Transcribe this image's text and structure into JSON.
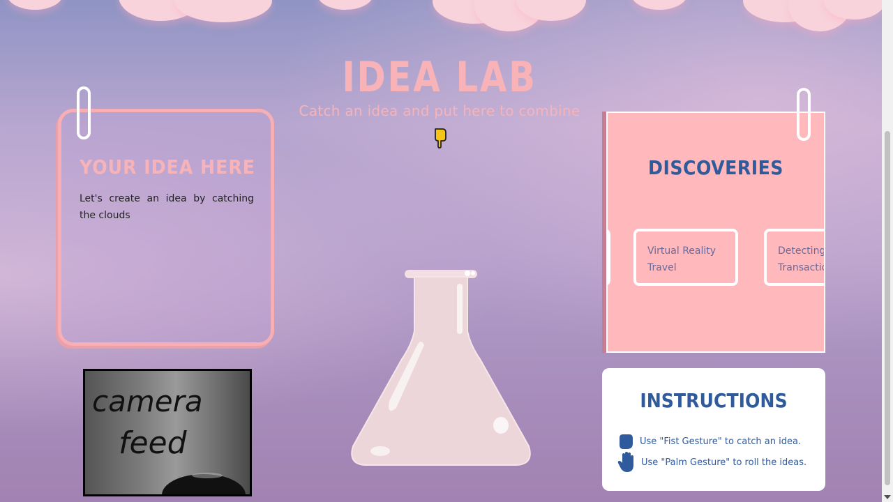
{
  "header": {
    "title": "IDEA LAB",
    "subtitle": "Catch an idea and put here to combine"
  },
  "idea_card": {
    "heading": "YOUR IDEA HERE",
    "text": "Let's create an idea by catching the clouds"
  },
  "discoveries": {
    "heading": "DISCOVERIES",
    "items": [
      {
        "label": ""
      },
      {
        "label": "Virtual Reality Travel"
      },
      {
        "label": "Detecting Transactions"
      }
    ]
  },
  "camera": {
    "label_line1": "camera",
    "label_line2": "feed"
  },
  "instructions": {
    "heading": "INSTRUCTIONS",
    "fist": "Use \"Fist Gesture\" to catch an idea.",
    "palm": "Use \"Palm Gesture\" to roll the ideas."
  },
  "colors": {
    "accent_pink": "#f7b3b8",
    "card_pink": "#ffb8bb",
    "text_blue": "#2f5a9b",
    "cursor_yellow": "#f5c518"
  },
  "icons": [
    "fist-icon",
    "palm-icon",
    "paperclip-icon",
    "hand-cursor-icon",
    "flask-icon"
  ]
}
